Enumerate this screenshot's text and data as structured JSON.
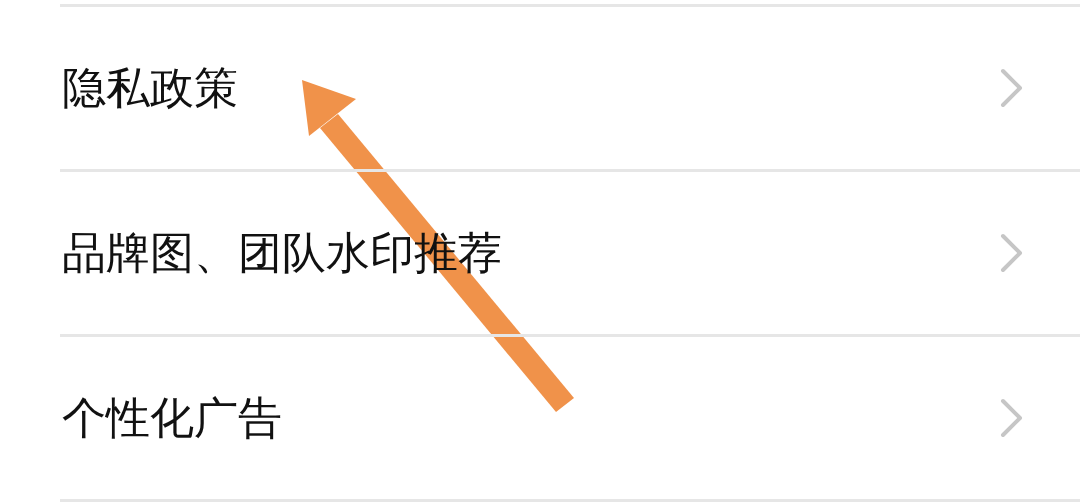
{
  "settings_list": {
    "items": [
      {
        "label": "隐私政策",
        "kind": "link"
      },
      {
        "label": "品牌图、团队水印推荐",
        "kind": "link"
      },
      {
        "label": "个性化广告",
        "kind": "link"
      }
    ]
  },
  "annotations": [
    {
      "kind": "arrow",
      "color": "#f0924a"
    }
  ]
}
